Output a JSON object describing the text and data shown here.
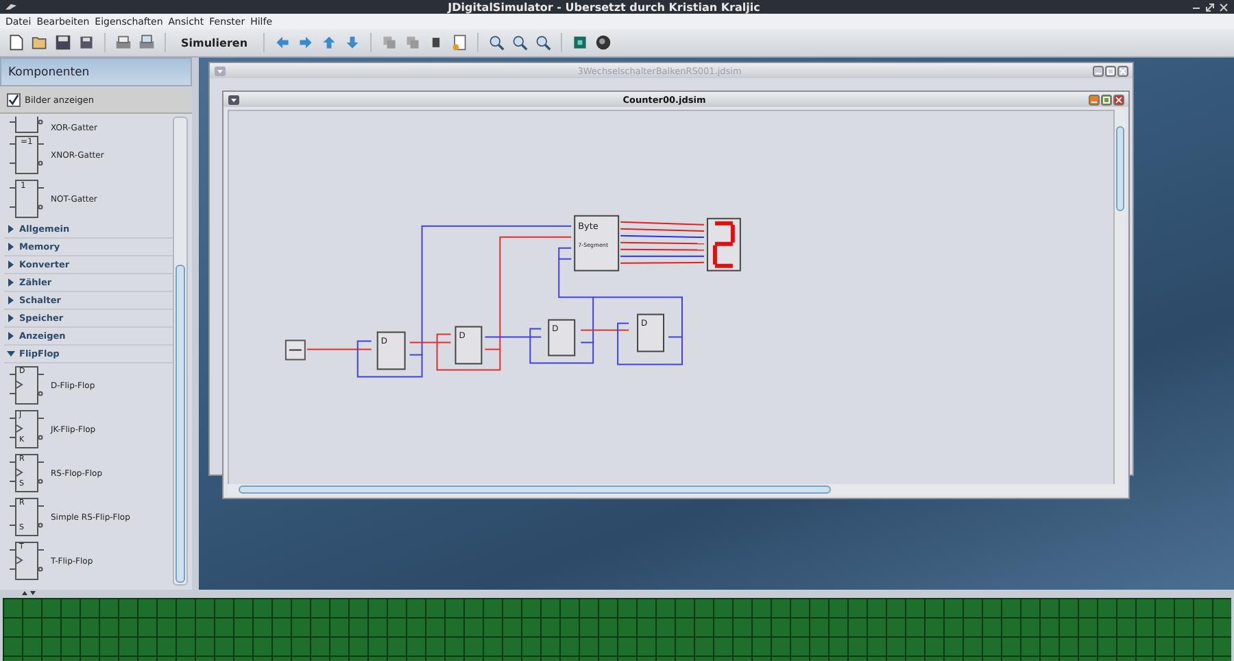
{
  "window": {
    "title": "JDigitalSimulator - Ubersetzt durch Kristian Kraljic"
  },
  "menu": [
    {
      "label": "Datei"
    },
    {
      "label": "Bearbeiten"
    },
    {
      "label": "Eigenschaften"
    },
    {
      "label": "Ansicht"
    },
    {
      "label": "Fenster"
    },
    {
      "label": "Hilfe"
    }
  ],
  "toolbar": {
    "simulate_label": "Simulieren"
  },
  "sidebar": {
    "title": "Komponenten",
    "show_images": {
      "label": "Bilder anzeigen",
      "checked": true
    },
    "items": [
      {
        "kind": "component",
        "label": "XOR-Gatter"
      },
      {
        "kind": "component",
        "label": "XNOR-Gatter",
        "symbol": "=1"
      },
      {
        "kind": "component",
        "label": "NOT-Gatter",
        "symbol": "1"
      },
      {
        "kind": "category",
        "label": "Allgemein",
        "expanded": false
      },
      {
        "kind": "category",
        "label": "Memory",
        "expanded": false
      },
      {
        "kind": "category",
        "label": "Konverter",
        "expanded": false
      },
      {
        "kind": "category",
        "label": "Zähler",
        "expanded": false
      },
      {
        "kind": "category",
        "label": "Schalter",
        "expanded": false
      },
      {
        "kind": "category",
        "label": "Speicher",
        "expanded": false
      },
      {
        "kind": "category",
        "label": "Anzeigen",
        "expanded": false
      },
      {
        "kind": "category",
        "label": "FlipFlop",
        "expanded": true,
        "children": [
          {
            "kind": "component",
            "label": "D-Flip-Flop",
            "pins": [
              "D"
            ],
            "clock": true
          },
          {
            "kind": "component",
            "label": "JK-Flip-Flop",
            "pins": [
              "J",
              "K"
            ],
            "clock": true
          },
          {
            "kind": "component",
            "label": "RS-Flop-Flop",
            "pins": [
              "R",
              "S"
            ],
            "clock": true
          },
          {
            "kind": "component",
            "label": "Simple RS-Flip-Flop",
            "pins": [
              "R",
              "S"
            ],
            "clock": false
          },
          {
            "kind": "component",
            "label": "T-Flip-Flop",
            "pins": [
              "T"
            ],
            "clock": true
          }
        ]
      }
    ]
  },
  "documents": [
    {
      "title": "3WechselschalterBalkenRS001.jdsim",
      "active": false
    },
    {
      "title": "Counter00.jdsim",
      "active": true
    }
  ],
  "circuit": {
    "flip_flops": [
      {
        "label": "D"
      },
      {
        "label": "D"
      },
      {
        "label": "D"
      },
      {
        "label": "D"
      }
    ],
    "converter": {
      "title": "Byte",
      "subtitle": "7-Segment"
    }
  }
}
